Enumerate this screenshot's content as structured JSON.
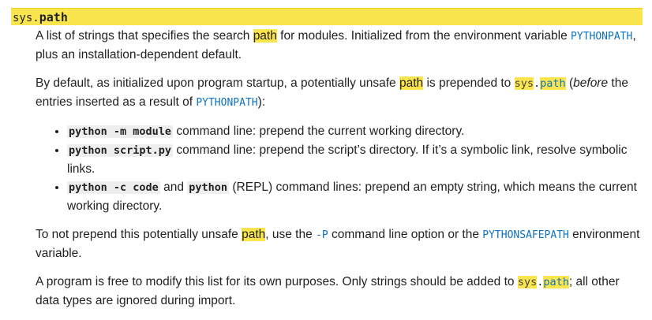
{
  "signature": {
    "module": "sys",
    "dot": ".",
    "name": "path"
  },
  "p1": {
    "t1": "A list of strings that specifies the search ",
    "hl": "path",
    "t2": " for modules. Initialized from the environment variable ",
    "code1": "PYTHONPATH",
    "t3": ", plus an installation-dependent default."
  },
  "p2": {
    "t1": "By default, as initialized upon program startup, a potentially unsafe ",
    "hl": "path",
    "t2": " is prepended to ",
    "sys": "sys",
    "dot": ".",
    "path": "path",
    "t3": " (",
    "em": "before",
    "t4": " the entries inserted as a result of ",
    "code1": "PYTHONPATH",
    "t5": "):"
  },
  "bullets": [
    {
      "code": "python -m module",
      "text": " command line: prepend the current working directory."
    },
    {
      "code": "python script.py",
      "text": " command line: prepend the script’s directory. If it’s a symbolic link, resolve symbolic links."
    },
    {
      "code": "python -c code",
      "mid": " and ",
      "code2": "python",
      "text": " (REPL) command lines: prepend an empty string, which means the current working directory."
    }
  ],
  "p3": {
    "t1": "To not prepend this potentially unsafe ",
    "hl": "path",
    "t2": ", use the ",
    "code1": "-P",
    "t3": " command line option or the ",
    "code2": "PYTHONSAFEPATH",
    "t4": " environment variable."
  },
  "p4": {
    "t1": "A program is free to modify this list for its own purposes. Only strings should be added to ",
    "sys": "sys",
    "dot": ".",
    "path": "path",
    "t2": "; all other data types are ignored during import."
  }
}
